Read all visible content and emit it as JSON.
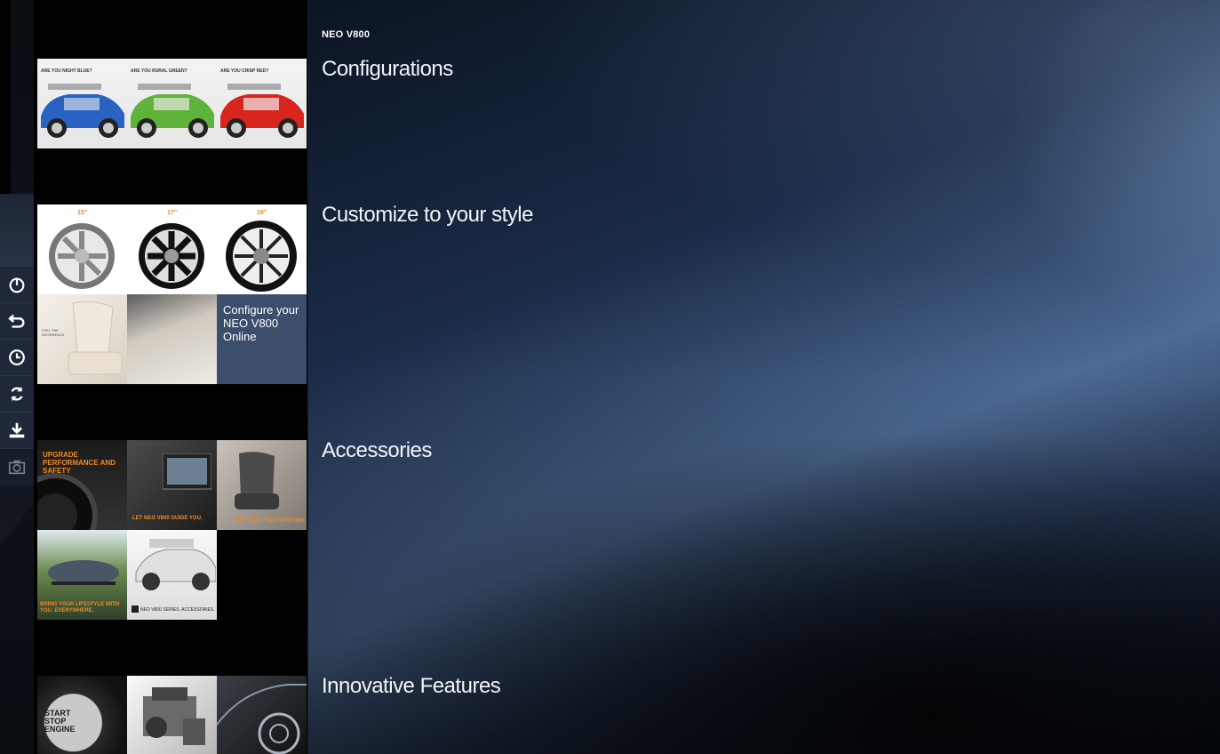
{
  "brand": "NEO V800",
  "toolbar": {
    "items": [
      {
        "icon": "power-icon"
      },
      {
        "icon": "back-icon"
      },
      {
        "icon": "clock-icon"
      },
      {
        "icon": "refresh-icon"
      },
      {
        "icon": "download-icon"
      },
      {
        "icon": "camera-icon",
        "disabled": true
      }
    ]
  },
  "sections": [
    {
      "title": "Configurations",
      "thumbnails": [
        {
          "caption": "ARE YOU NIGHT BLUE?",
          "color": "#2a62c4"
        },
        {
          "caption": "ARE YOU RURAL GREEN?",
          "color": "#5fb33a"
        },
        {
          "caption": "ARE YOU CRISP RED?",
          "color": "#d8261f"
        }
      ]
    },
    {
      "title": "Customize to your style",
      "thumbnails": [
        {
          "label": "15\""
        },
        {
          "label": "17\""
        },
        {
          "label": "19\""
        },
        {
          "label": "FEEL THE DIFFERENCE"
        },
        {
          "label": ""
        },
        {
          "label": "Configure your NEO V800 Online"
        }
      ]
    },
    {
      "title": "Accessories",
      "thumbnails": [
        {
          "label": "UPGRADE PERFORMANCE AND SAFETY"
        },
        {
          "label": "LET NEO V800 GUIDE YOU."
        },
        {
          "label": "NEO V800 FOR EVERYONE"
        },
        {
          "label": "BRING YOUR LIFESTYLE WITH YOU. EVERYWHERE."
        },
        {
          "label": "NEO V800 SERIES. ACCESSORIES."
        }
      ]
    },
    {
      "title": "Innovative Features",
      "thumbnails": [
        {
          "label": "START STOP ENGINE"
        },
        {
          "label": ""
        },
        {
          "label": ""
        }
      ]
    }
  ]
}
